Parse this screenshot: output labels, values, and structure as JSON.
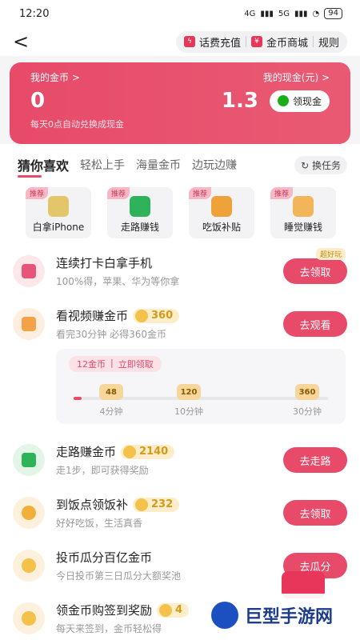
{
  "status": {
    "time": "12:20",
    "net1": "4G",
    "net2": "5G",
    "battery": "94"
  },
  "topbar": {
    "back": "<",
    "recharge": "话费充值",
    "mall": "金币商城",
    "rules": "规则"
  },
  "hero": {
    "coins_label": "我的金币 >",
    "cash_label": "我的现金(元) >",
    "coins_value": "0",
    "cash_value": "1.3",
    "cash_button": "领现金",
    "note": "每天0点自动兑换成现金"
  },
  "tabs": {
    "items": [
      "猜你喜欢",
      "轻松上手",
      "海量金币",
      "边玩边赚"
    ],
    "switch": "换任务"
  },
  "features": [
    {
      "badge": "推荐",
      "label": "白拿iPhone",
      "color": "#e3c56a"
    },
    {
      "badge": "推荐",
      "label": "走路赚钱",
      "color": "#2fb35a"
    },
    {
      "badge": "推荐",
      "label": "吃饭补贴",
      "color": "#f0a23a"
    },
    {
      "badge": "推荐",
      "label": "睡觉赚钱",
      "color": "#f3b55a"
    }
  ],
  "tasks": [
    {
      "title": "连续打卡白拿手机",
      "sub": "100%得，苹果、华为等你拿",
      "btn": "去领取",
      "tag": "超好玩",
      "coins": ""
    },
    {
      "title": "看视频赚金币",
      "coins": "360",
      "sub": "看完30分钟 必得360金币",
      "btn": "去观看"
    },
    {
      "title": "走路赚金币",
      "coins": "2140",
      "sub": "走1步，即可获得奖励",
      "btn": "去走路"
    },
    {
      "title": "到饭点领饭补",
      "coins": "232",
      "sub": "好好吃饭，生活真香",
      "btn": "去领取"
    },
    {
      "title": "投币瓜分百亿金币",
      "sub": "今日投币第三日瓜分大额奖池",
      "btn": "去瓜分",
      "coins": ""
    },
    {
      "title": "领金币购签到奖励",
      "coins": "4",
      "sub": "每天来签到，金币轻松得",
      "btn": ""
    }
  ],
  "progress": {
    "pill_coins": "12金币",
    "pill_action": "立即领取",
    "fill_fraction": 0.03,
    "milestones": [
      {
        "value": "48",
        "label": "4分钟"
      },
      {
        "value": "120",
        "label": "10分钟"
      },
      {
        "value": "360",
        "label": "30分钟"
      }
    ]
  },
  "watermark": {
    "text": "巨型手游网"
  },
  "colors": {
    "accent": "#e84a6a",
    "coin": "#f4c24b"
  }
}
